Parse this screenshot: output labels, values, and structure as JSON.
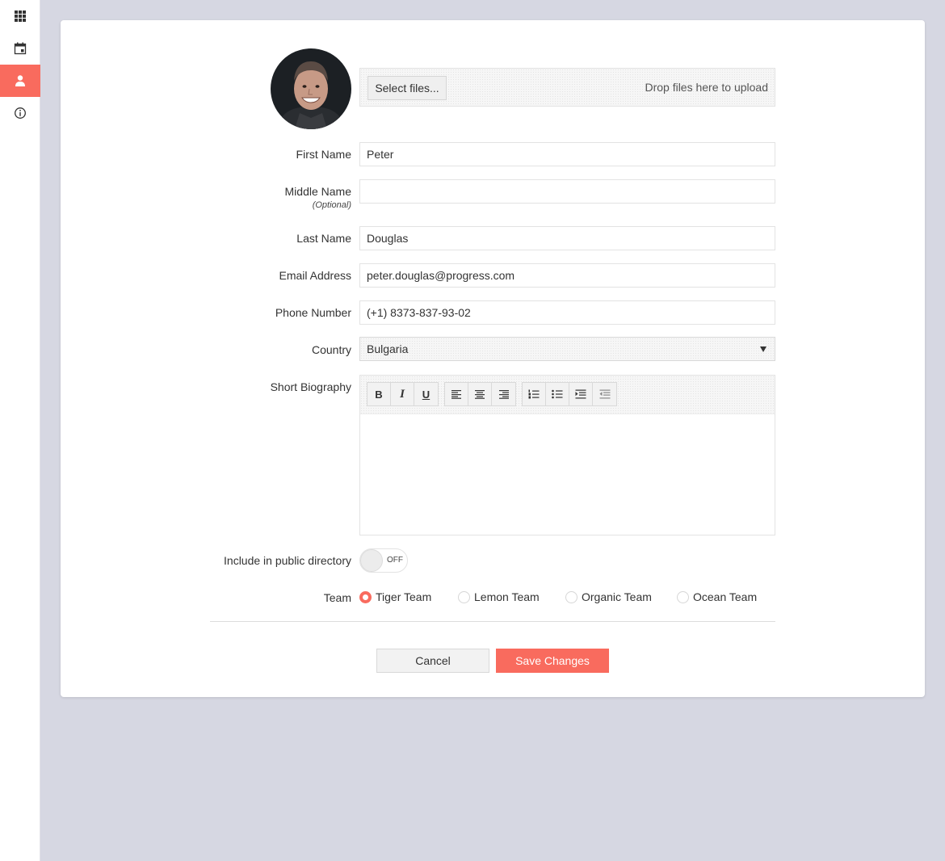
{
  "colors": {
    "accent": "#f96b5e",
    "background": "#d6d7e2",
    "card": "#ffffff"
  },
  "sidebar": {
    "items": [
      {
        "icon": "grid-icon",
        "active": false
      },
      {
        "icon": "calendar-icon",
        "active": false
      },
      {
        "icon": "user-icon",
        "active": true
      },
      {
        "icon": "info-icon",
        "active": false
      }
    ]
  },
  "upload": {
    "select_label": "Select files...",
    "drop_hint": "Drop files here to upload"
  },
  "form": {
    "first_name": {
      "label": "First Name",
      "value": "Peter"
    },
    "middle_name": {
      "label": "Middle Name",
      "sublabel": "(Optional)",
      "value": ""
    },
    "last_name": {
      "label": "Last Name",
      "value": "Douglas"
    },
    "email": {
      "label": "Email Address",
      "value": "peter.douglas@progress.com"
    },
    "phone": {
      "label": "Phone Number",
      "value": "(+1) 8373-837-93-02"
    },
    "country": {
      "label": "Country",
      "value": "Bulgaria"
    },
    "biography": {
      "label": "Short Biography",
      "toolbar": {
        "bold": "B",
        "italic": "I",
        "underline": "U",
        "icons": [
          "bold-icon",
          "italic-icon",
          "underline-icon",
          "align-left-icon",
          "align-center-icon",
          "align-right-icon",
          "ordered-list-icon",
          "unordered-list-icon",
          "indent-icon",
          "outdent-icon"
        ]
      },
      "value": ""
    },
    "public_directory": {
      "label": "Include in public directory",
      "state_text": "OFF",
      "checked": false
    },
    "team": {
      "label": "Team",
      "options": [
        {
          "label": "Tiger Team",
          "checked": true
        },
        {
          "label": "Lemon Team",
          "checked": false
        },
        {
          "label": "Organic Team",
          "checked": false
        },
        {
          "label": "Ocean Team",
          "checked": false
        }
      ]
    }
  },
  "actions": {
    "cancel_label": "Cancel",
    "save_label": "Save Changes"
  }
}
